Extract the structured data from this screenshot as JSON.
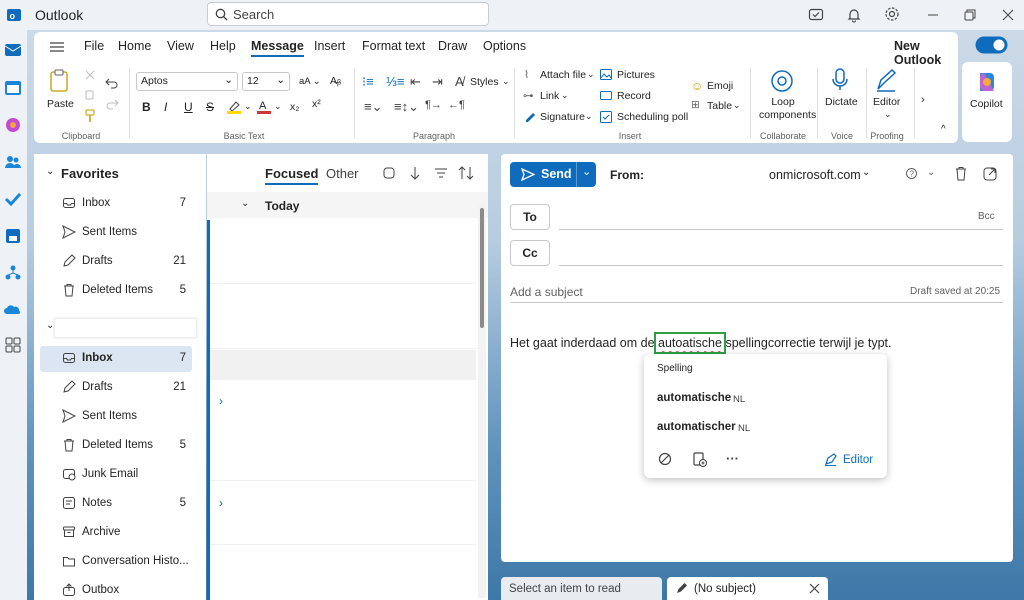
{
  "window": {
    "title": "Outlook"
  },
  "search": {
    "placeholder": "Search"
  },
  "ribbon": {
    "menus": [
      "File",
      "Home",
      "View",
      "Help",
      "Message",
      "Insert",
      "Format text",
      "Draw",
      "Options"
    ],
    "new_outlook_label": "New Outlook",
    "paste": "Paste",
    "clipboard": "Clipboard",
    "font_name": "Aptos",
    "font_size": "12",
    "basic_text": "Basic Text",
    "styles": "Styles",
    "paragraph": "Paragraph",
    "attach_file": "Attach file",
    "link": "Link",
    "signature": "Signature",
    "pictures": "Pictures",
    "record": "Record",
    "scheduling_poll": "Scheduling poll",
    "emoji": "Emoji",
    "table": "Table",
    "insert": "Insert",
    "loop_components": "Loop components",
    "collaborate": "Collaborate",
    "dictate": "Dictate",
    "voice": "Voice",
    "editor": "Editor",
    "proofing": "Proofing",
    "copilot": "Copilot"
  },
  "folders": {
    "favorites_label": "Favorites",
    "favorites": [
      {
        "label": "Inbox",
        "count": "7",
        "icon": "inbox-icon"
      },
      {
        "label": "Sent Items",
        "count": "",
        "icon": "send-icon"
      },
      {
        "label": "Drafts",
        "count": "21",
        "icon": "pencil-icon"
      },
      {
        "label": "Deleted Items",
        "count": "5",
        "icon": "trash-icon"
      }
    ],
    "account": [
      {
        "label": "Inbox",
        "count": "7",
        "icon": "inbox-icon"
      },
      {
        "label": "Drafts",
        "count": "21",
        "icon": "pencil-icon"
      },
      {
        "label": "Sent Items",
        "count": "",
        "icon": "send-icon"
      },
      {
        "label": "Deleted Items",
        "count": "5",
        "icon": "trash-icon"
      },
      {
        "label": "Junk Email",
        "count": "",
        "icon": "junk-icon"
      },
      {
        "label": "Notes",
        "count": "5",
        "icon": "notes-icon"
      },
      {
        "label": "Archive",
        "count": "",
        "icon": "archive-icon"
      },
      {
        "label": "Conversation Histo...",
        "count": "",
        "icon": "folder-icon"
      },
      {
        "label": "Outbox",
        "count": "",
        "icon": "outbox-icon"
      }
    ]
  },
  "message_list": {
    "focused": "Focused",
    "other": "Other",
    "group": "Today"
  },
  "compose": {
    "send": "Send",
    "from_label": "From:",
    "from_account": "onmicrosoft.com",
    "to": "To",
    "bcc": "Bcc",
    "cc": "Cc",
    "subject_placeholder": "Add a subject",
    "draft_saved": "Draft saved at 20:25",
    "body_before": "Het gaat inderdaad om de ",
    "body_misspelled": "autoatische",
    "body_after": " spellingcorrectie terwijl je typt."
  },
  "spelling_popup": {
    "title": "Spelling",
    "suggestions": [
      {
        "word": "automatische",
        "lang": "NL"
      },
      {
        "word": "automatischer",
        "lang": "NL"
      }
    ],
    "editor_label": "Editor"
  },
  "bottom_tabs": {
    "reading": "Select an item to read",
    "draft": "(No subject)"
  },
  "colors": {
    "accent": "#0f6cbd",
    "selection": "#dce6f3",
    "highlight_box": "#2ea043",
    "misspell": "#d13438"
  }
}
